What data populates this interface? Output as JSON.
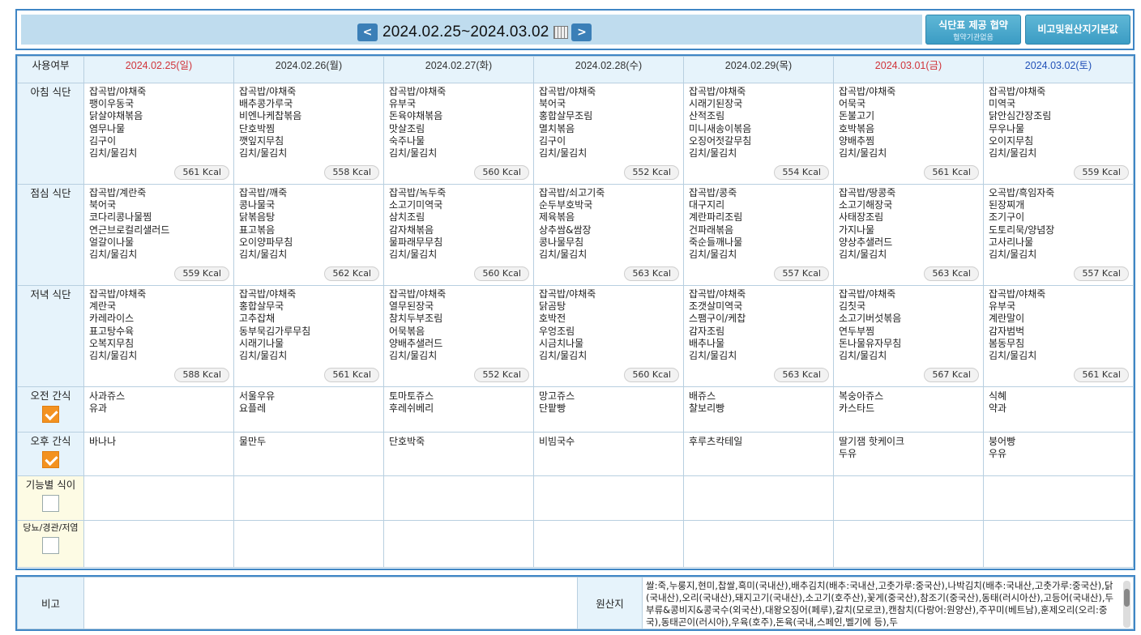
{
  "header": {
    "date_range": "2024.02.25~2024.03.02",
    "prev_label": "<",
    "next_label": ">",
    "btn_agreement": "식단표 제공 협약",
    "btn_agreement_sub": "협약기관없음",
    "btn_notes": "비고및원산지기본값"
  },
  "table": {
    "corner_label": "사용여부",
    "days": [
      {
        "label": "2024.02.25(일)",
        "kind": "sun"
      },
      {
        "label": "2024.02.26(월)",
        "kind": "wk"
      },
      {
        "label": "2024.02.27(화)",
        "kind": "wk"
      },
      {
        "label": "2024.02.28(수)",
        "kind": "wk"
      },
      {
        "label": "2024.02.29(목)",
        "kind": "wk"
      },
      {
        "label": "2024.03.01(금)",
        "kind": "sun"
      },
      {
        "label": "2024.03.02(토)",
        "kind": "sat"
      }
    ],
    "meals": [
      {
        "label": "아침 식단",
        "cells": [
          {
            "items": [
              "잡곡밥/야채죽",
              "팽이우동국",
              "닭살야채볶음",
              "염무나물",
              "김구이",
              "김치/물김치"
            ],
            "kcal": "561 Kcal"
          },
          {
            "items": [
              "잡곡밥/야채죽",
              "배추콩가루국",
              "비엔나케찹볶음",
              "단호박찜",
              "깻잎지무침",
              "김치/물김치"
            ],
            "kcal": "558 Kcal"
          },
          {
            "items": [
              "잡곡밥/야채죽",
              "유부국",
              "돈육야채볶음",
              "맛살조림",
              "숙주나물",
              "김치/물김치"
            ],
            "kcal": "560 Kcal"
          },
          {
            "items": [
              "잡곡밥/야채죽",
              "북어국",
              "홍합살무조림",
              "멸치볶음",
              "김구이",
              "김치/물김치"
            ],
            "kcal": "552 Kcal"
          },
          {
            "items": [
              "잡곡밥/야채죽",
              "시래기된장국",
              "산적조림",
              "미니새송이볶음",
              "오징어젓갈무침",
              "김치/물김치"
            ],
            "kcal": "554 Kcal"
          },
          {
            "items": [
              "잡곡밥/야채죽",
              "어묵국",
              "돈불고기",
              "호박볶음",
              "양배추찜",
              "김치/물김치"
            ],
            "kcal": "561 Kcal"
          },
          {
            "items": [
              "잡곡밥/야채죽",
              "미역국",
              "닭안심간장조림",
              "무우나물",
              "오이지무침",
              "김치/물김치"
            ],
            "kcal": "559 Kcal"
          }
        ]
      },
      {
        "label": "점심 식단",
        "cells": [
          {
            "items": [
              "잡곡밥/계란죽",
              "북어국",
              "코다리콩나물찜",
              "연근브로컬리샐러드",
              "얼갈이나물",
              "김치/물김치"
            ],
            "kcal": "559 Kcal"
          },
          {
            "items": [
              "잡곡밥/깨죽",
              "콩나물국",
              "닭볶음탕",
              "표고볶음",
              "오이양파무침",
              "김치/물김치"
            ],
            "kcal": "562 Kcal"
          },
          {
            "items": [
              "잡곡밥/녹두죽",
              "소고기미역국",
              "삼치조림",
              "감자채볶음",
              "물파래무무침",
              "김치/물김치"
            ],
            "kcal": "560 Kcal"
          },
          {
            "items": [
              "잡곡밥/쇠고기죽",
              "순두부호박국",
              "제육볶음",
              "상추쌈&쌈장",
              "콩나물무침",
              "김치/물김치"
            ],
            "kcal": "563 Kcal"
          },
          {
            "items": [
              "잡곡밥/콩죽",
              "대구지리",
              "계란파리조림",
              "건파래볶음",
              "죽순들깨나물",
              "김치/물김치"
            ],
            "kcal": "557 Kcal"
          },
          {
            "items": [
              "잡곡밥/땅콩죽",
              "소고기해장국",
              "사태장조림",
              "가지나물",
              "양상추샐러드",
              "김치/물김치"
            ],
            "kcal": "563 Kcal"
          },
          {
            "items": [
              "오곡밥/흑임자죽",
              "된장찌개",
              "조기구이",
              "도토리묵/양념장",
              "고사리나물",
              "김치/물김치"
            ],
            "kcal": "557 Kcal"
          }
        ]
      },
      {
        "label": "저녁 식단",
        "cells": [
          {
            "items": [
              "잡곡밥/야채죽",
              "계란국",
              "카레라이스",
              "표고탕수육",
              "오복지무침",
              "김치/물김치"
            ],
            "kcal": "588 Kcal"
          },
          {
            "items": [
              "잡곡밥/야채죽",
              "홍합살무국",
              "고추잡채",
              "동부묵김가루무침",
              "시래기나물",
              "김치/물김치"
            ],
            "kcal": "561 Kcal"
          },
          {
            "items": [
              "잡곡밥/야채죽",
              "열무된장국",
              "참치두부조림",
              "어묵볶음",
              "양배추샐러드",
              "김치/물김치"
            ],
            "kcal": "552 Kcal"
          },
          {
            "items": [
              "잡곡밥/야채죽",
              "닭곰탕",
              "호박전",
              "우엉조림",
              "시금치나물",
              "김치/물김치"
            ],
            "kcal": "560 Kcal"
          },
          {
            "items": [
              "잡곡밥/야채죽",
              "조갯살미역국",
              "스팸구이/케찹",
              "감자조림",
              "배추나물",
              "김치/물김치"
            ],
            "kcal": "563 Kcal"
          },
          {
            "items": [
              "잡곡밥/야채죽",
              "김칫국",
              "소고기버섯볶음",
              "연두부찜",
              "돈나물유자무침",
              "김치/물김치"
            ],
            "kcal": "567 Kcal"
          },
          {
            "items": [
              "잡곡밥/야채죽",
              "유부국",
              "계란말이",
              "감자범벅",
              "봄동무침",
              "김치/물김치"
            ],
            "kcal": "561 Kcal"
          }
        ]
      }
    ],
    "snacks": [
      {
        "label": "오전 간식",
        "checked": true,
        "cells": [
          [
            "사과쥬스",
            "유과"
          ],
          [
            "서울우유",
            "요플레"
          ],
          [
            "토마토쥬스",
            "후레쉬베리"
          ],
          [
            "망고쥬스",
            "단팥빵"
          ],
          [
            "배쥬스",
            "찰보리빵"
          ],
          [
            "복숭아쥬스",
            "카스타드"
          ],
          [
            "식혜",
            "약과"
          ]
        ]
      },
      {
        "label": "오후 간식",
        "checked": true,
        "cells": [
          [
            "바나나"
          ],
          [
            "물만두"
          ],
          [
            "단호박죽"
          ],
          [
            "비빔국수"
          ],
          [
            "후루츠칵테일"
          ],
          [
            "딸기잼 핫케이크",
            "두유"
          ],
          [
            "붕어빵",
            "우유"
          ]
        ]
      }
    ],
    "special": [
      {
        "label": "기능별 식이",
        "checked": false
      },
      {
        "label": "당뇨/경관/저염",
        "checked": false
      }
    ]
  },
  "footer": {
    "notes_label": "비고",
    "notes_value": "",
    "origin_label": "원산지",
    "origin_text": "쌀:죽,누룽지,현미,찹쌀,흑미(국내산),배추김치(배추:국내산,고춧가루:중국산),나박김치(배추:국내산,고춧가루:중국산),닭(국내산),오리(국내산),돼지고기(국내산),소고기(호주산),꽃게(중국산),참조기(중국산),동태(러시아산),고등어(국내산),두부류&콩비지&콩국수(외국산),대왕오징어(페루),갈치(모로코),캔참치(다랑어:원양산),주꾸미(베트남),훈제오리(오리:중국),동태곤이(러시아),우육(호주),돈육(국내,스페인,벨기에 등),두"
  }
}
